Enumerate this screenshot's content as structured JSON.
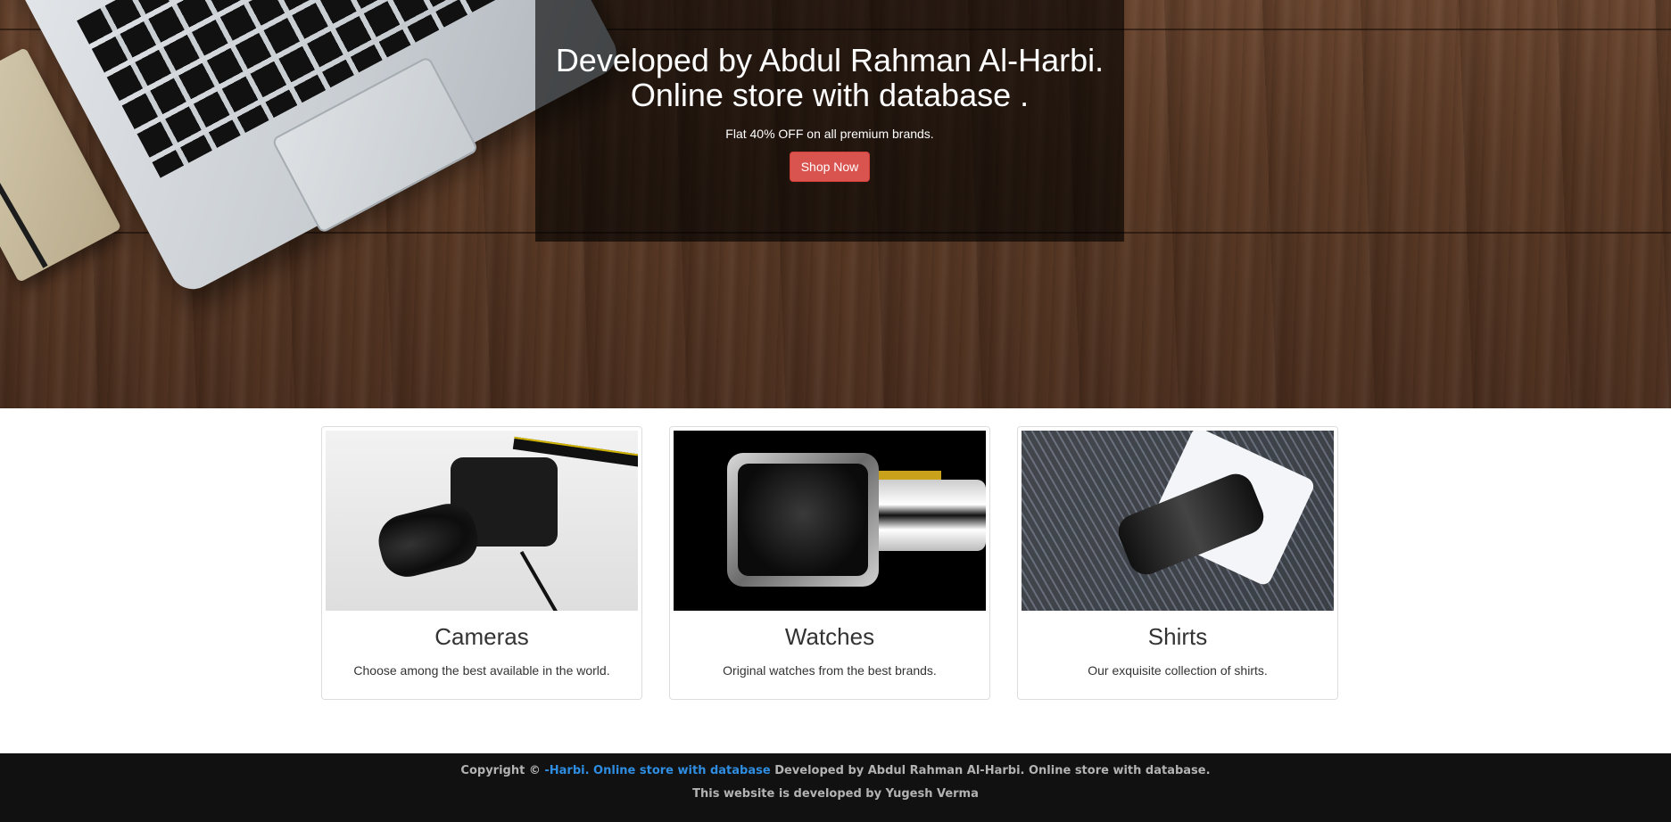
{
  "hero": {
    "heading_line1": "Developed by Abdul Rahman Al-Harbi.",
    "heading_line2": "Online store with database .",
    "tagline": "Flat 40% OFF on all premium brands.",
    "shop_button": "Shop Now",
    "button_color": "#d9534f"
  },
  "categories": [
    {
      "title": "Cameras",
      "description": "Choose among the best available in the world."
    },
    {
      "title": "Watches",
      "description": "Original watches from the best brands."
    },
    {
      "title": "Shirts",
      "description": "Our exquisite collection of shirts."
    }
  ],
  "footer": {
    "copyright_prefix": "Copyright ©",
    "link_text": "-Harbi. Online store with database",
    "copyright_suffix": "Developed by Abdul Rahman Al-Harbi. Online store with database.",
    "credit": "This website is developed by Yugesh Verma",
    "link_color": "#2e8de0",
    "background": "#111111"
  }
}
